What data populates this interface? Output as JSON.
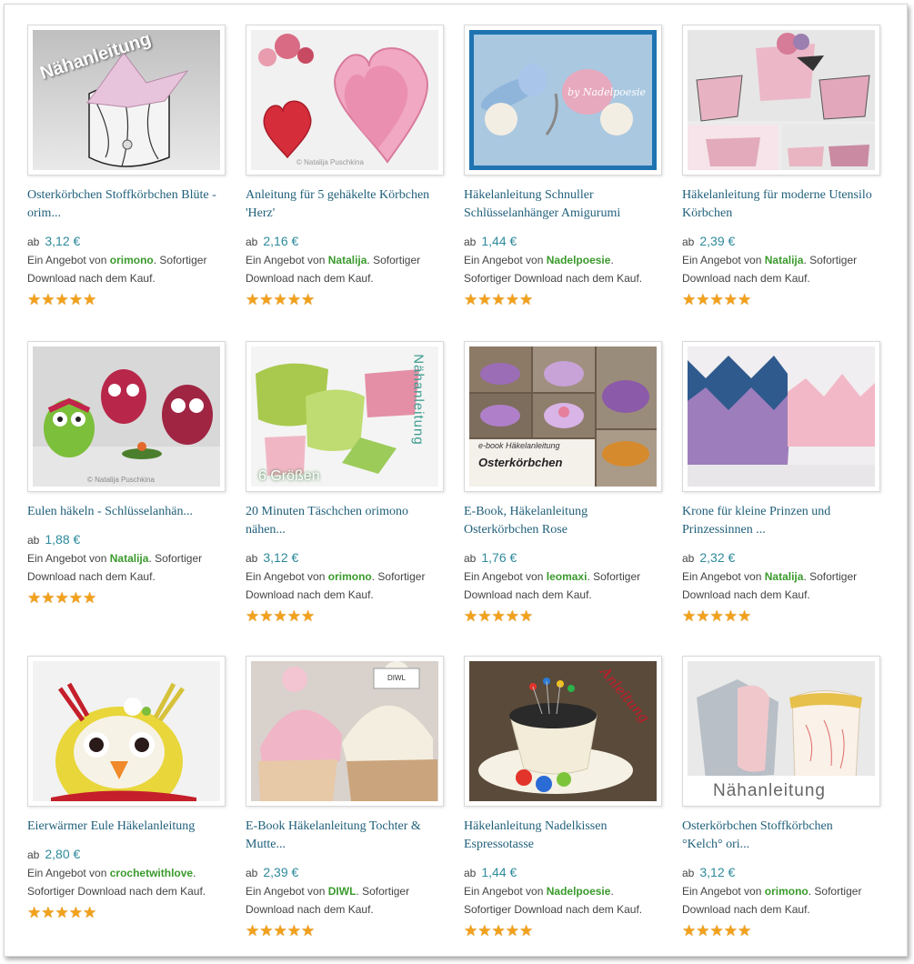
{
  "products": [
    {
      "title": "Osterkörbchen Stoffkörbchen Blüte - orim...",
      "prefix": "ab",
      "price": "3,12 €",
      "offer_before": "Ein Angebot von",
      "seller": "orimono",
      "offer_after": ". Sofortiger Download nach dem Kauf.",
      "rating": 5,
      "image": "fabric-flower-basket-thumbnail",
      "watermark": "Nähanleitung"
    },
    {
      "title": "Anleitung für 5 gehäkelte Körbchen 'Herz'",
      "prefix": "ab",
      "price": "2,16 €",
      "offer_before": "Ein Angebot von",
      "seller": "Natalija",
      "offer_after": ". Sofortiger Download nach dem Kauf.",
      "rating": 5,
      "image": "heart-baskets-thumbnail",
      "watermark": "© Natalija Puschkina"
    },
    {
      "title": "Häkelanleitung Schnuller Schlüsselanhänger Amigurumi",
      "prefix": "ab",
      "price": "1,44 €",
      "offer_before": "Ein Angebot von",
      "seller": "Nadelpoesie",
      "offer_after": ". Sofortiger Download nach dem Kauf.",
      "rating": 5,
      "image": "pacifier-keychain-thumbnail",
      "watermark": "by Nadelpoesie"
    },
    {
      "title": "Häkelanleitung für moderne Utensilo Körbchen",
      "prefix": "ab",
      "price": "2,39 €",
      "offer_before": "Ein Angebot von",
      "seller": "Natalija",
      "offer_after": ". Sofortiger Download nach dem Kauf.",
      "rating": 5,
      "image": "utensilo-baskets-thumbnail",
      "watermark": ""
    },
    {
      "title": "Eulen häkeln - Schlüsselanhän...",
      "prefix": "ab",
      "price": "1,88 €",
      "offer_before": "Ein Angebot von",
      "seller": "Natalija",
      "offer_after": ". Sofortiger Download nach dem Kauf.",
      "rating": 5,
      "image": "crochet-owls-thumbnail",
      "watermark": "© Natalija Puschkina"
    },
    {
      "title": "20 Minuten Täschchen orimono nähen...",
      "prefix": "ab",
      "price": "3,12 €",
      "offer_before": "Ein Angebot von",
      "seller": "orimono",
      "offer_after": ". Sofortiger Download nach dem Kauf.",
      "rating": 5,
      "image": "fabric-pouches-thumbnail",
      "watermark": "Nähanleitung",
      "watermark2": "6 Größen"
    },
    {
      "title": "E-Book, Häkelanleitung Osterkörbchen Rose",
      "prefix": "ab",
      "price": "1,76 €",
      "offer_before": "Ein Angebot von",
      "seller": "leomaxi",
      "offer_after": ". Sofortiger Download nach dem Kauf.",
      "rating": 5,
      "image": "rose-easter-baskets-thumbnail",
      "watermark": "e-book Häkelanleitung",
      "watermark2": "Osterkörbchen"
    },
    {
      "title": "Krone für kleine Prinzen und Prinzessinnen ...",
      "prefix": "ab",
      "price": "2,32 €",
      "offer_before": "Ein Angebot von",
      "seller": "Natalija",
      "offer_after": ". Sofortiger Download nach dem Kauf.",
      "rating": 5,
      "image": "crochet-crowns-thumbnail",
      "watermark": ""
    },
    {
      "title": "Eierwärmer Eule Häkelanleitung",
      "prefix": "ab",
      "price": "2,80 €",
      "offer_before": "Ein Angebot von",
      "seller": "crochetwithlove",
      "offer_after": ". Sofortiger Download nach dem Kauf.",
      "rating": 5,
      "image": "owl-egg-warmer-thumbnail",
      "watermark": ""
    },
    {
      "title": "E-Book Häkelanleitung Tochter & Mutte...",
      "prefix": "ab",
      "price": "2,39 €",
      "offer_before": "Ein Angebot von",
      "seller": "DIWL",
      "offer_after": ". Sofortiger Download nach dem Kauf.",
      "rating": 5,
      "image": "crochet-hats-thumbnail",
      "watermark": "DIWL"
    },
    {
      "title": "Häkelanleitung Nadelkissen Espressotasse",
      "prefix": "ab",
      "price": "1,44 €",
      "offer_before": "Ein Angebot von",
      "seller": "Nadelpoesie",
      "offer_after": ". Sofortiger Download nach dem Kauf.",
      "rating": 5,
      "image": "espresso-pincushion-thumbnail",
      "watermark": "Anleitung"
    },
    {
      "title": "Osterkörbchen Stoffkörbchen °Kelch° ori...",
      "prefix": "ab",
      "price": "3,12 €",
      "offer_before": "Ein Angebot von",
      "seller": "orimono",
      "offer_after": ". Sofortiger Download nach dem Kauf.",
      "rating": 5,
      "image": "fabric-chalice-baskets-thumbnail",
      "watermark": "Nähanleitung"
    }
  ],
  "colors": {
    "title": "#1f5f7a",
    "price": "#2e8a9c",
    "seller": "#3a9a2c",
    "star": "#f2a11c"
  }
}
